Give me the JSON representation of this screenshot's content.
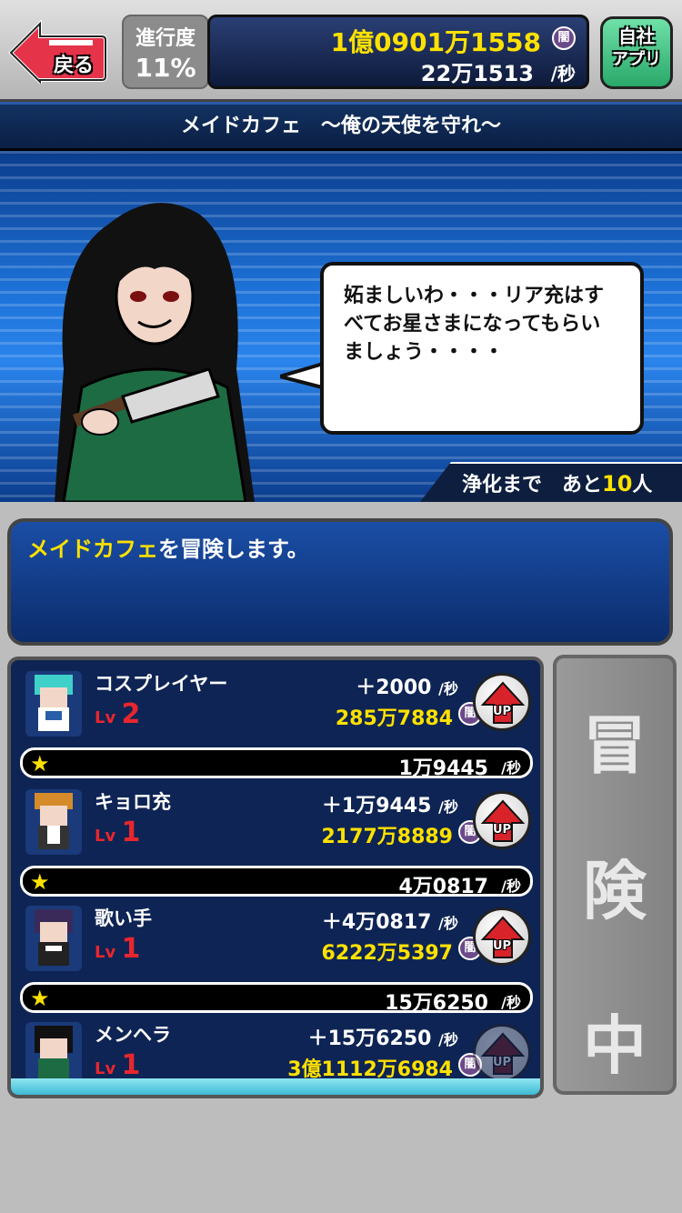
{
  "header": {
    "back_label": "戻る",
    "progress_label": "進行度",
    "progress_value": "11%",
    "money_total": "1億0901万1558",
    "money_rate": "22万1513",
    "rate_suffix": "/秒",
    "currency_badge": "闇",
    "app_label_line1": "自社",
    "app_label_line2": "アプリ"
  },
  "stage": {
    "title": "メイドカフェ　〜俺の天使を守れ〜"
  },
  "scene": {
    "speech": "妬ましいわ・・・リア充はすべてお星さまになってもらいましょう・・・・",
    "purify_prefix": "浄化まで　あと",
    "purify_count": "10",
    "purify_suffix": "人"
  },
  "message": {
    "highlight": "メイドカフェ",
    "text": "を冒険します。"
  },
  "units": [
    {
      "name": "コスプレイヤー",
      "lv_label": "Lv",
      "level": "2",
      "rate": "＋2000",
      "total": "285万7884"
    },
    {
      "name": "キョロ充",
      "lv_label": "Lv",
      "level": "1",
      "rate": "＋1万9445",
      "total": "2177万8889"
    },
    {
      "name": "歌い手",
      "lv_label": "Lv",
      "level": "1",
      "rate": "＋4万0817",
      "total": "6222万5397"
    },
    {
      "name": "メンヘラ",
      "lv_label": "Lv",
      "level": "1",
      "rate": "＋15万6250",
      "total": "3億1112万6984"
    }
  ],
  "star_bars": [
    {
      "value": "1万9445"
    },
    {
      "value": "4万0817"
    },
    {
      "value": "15万6250"
    }
  ],
  "per_sec": "/秒",
  "up_label": "UP",
  "adventuring": [
    "冒",
    "険",
    "中"
  ]
}
